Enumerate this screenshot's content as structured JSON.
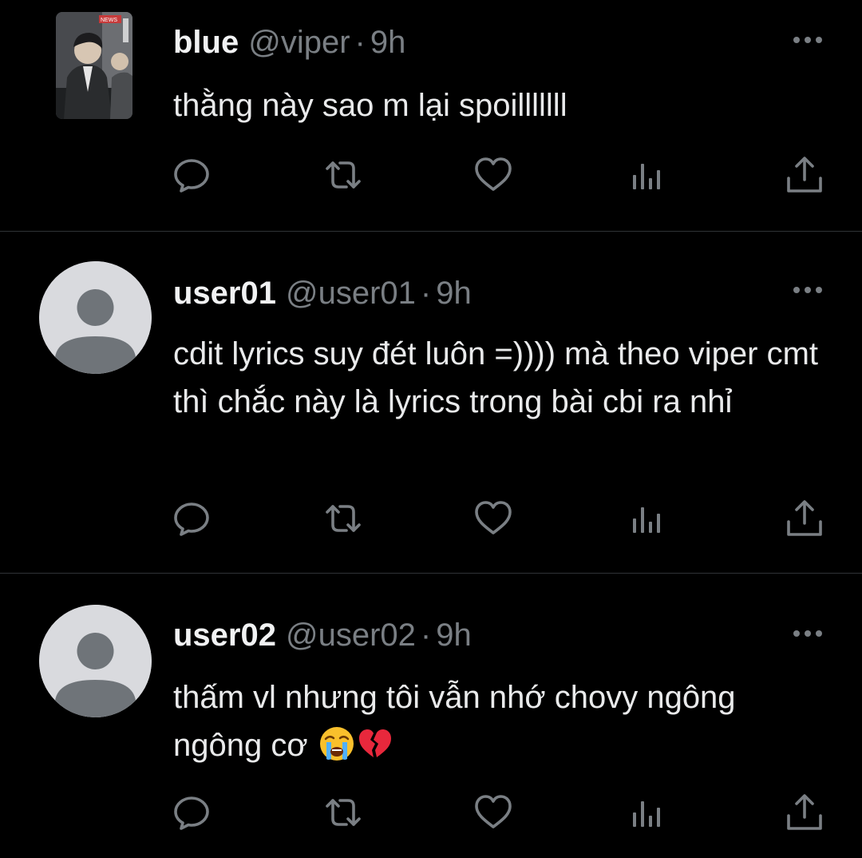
{
  "tweets": [
    {
      "name": "blue",
      "handle": "@viper",
      "separator": "·",
      "time": "9h",
      "text": "thằng này sao m lại spoilllllll",
      "avatar": "photo-avatar",
      "avatar_photo_text": "NEWS"
    },
    {
      "name": "user01",
      "handle": "@user01",
      "separator": "·",
      "time": "9h",
      "text": "cdit lyrics suy đét luôn =)))) mà theo viper cmt thì chắc này là lyrics trong bài cbi ra nhỉ",
      "avatar": "default-avatar"
    },
    {
      "name": "user02",
      "handle": "@user02",
      "separator": "·",
      "time": "9h",
      "text": "thấm vl nhưng tôi vẫn nhớ chovy ngông ngông cơ",
      "emojis": [
        "loudly-crying-face",
        "broken-heart"
      ],
      "avatar": "default-avatar"
    }
  ],
  "actions": [
    "reply-icon",
    "retweet-icon",
    "like-icon",
    "views-icon",
    "share-icon"
  ],
  "colors": {
    "background": "#000000",
    "text": "#e7e9ea",
    "secondary": "#7a7f84",
    "icon": "#7a7f84",
    "divider": "#2f3336",
    "default_avatar_bg": "#d9dade",
    "default_avatar_fg": "#6f7479"
  }
}
